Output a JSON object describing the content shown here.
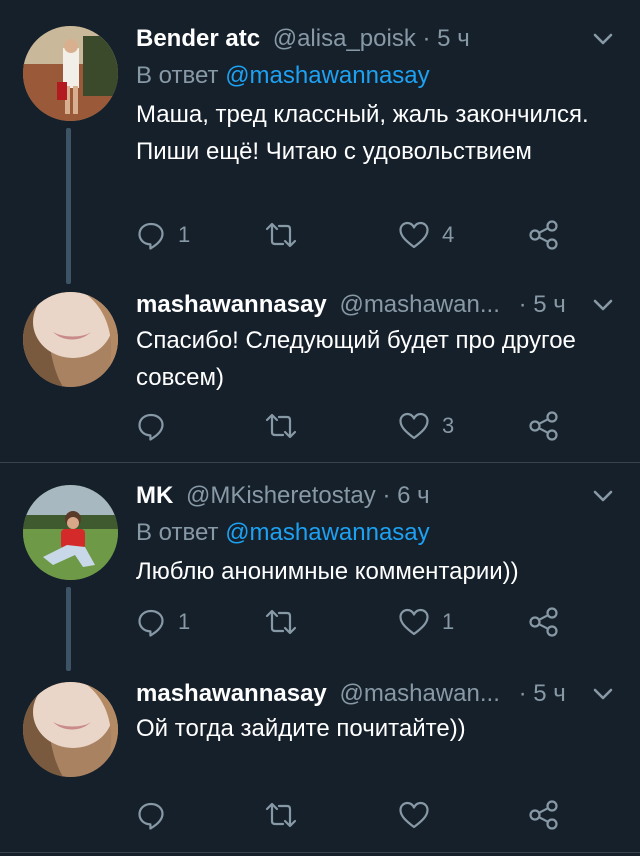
{
  "tweets": [
    {
      "name": "Bender atc",
      "handle": "@alisa_poisk",
      "dot": "·",
      "time": "5 ч",
      "reply_label": "В ответ",
      "reply_to": "@mashawannasay",
      "text": "Маша, тред классный, жаль закончился. Пиши ещё! Читаю с удовольствием",
      "reply_count": "1",
      "retweet_count": "",
      "like_count": "4"
    },
    {
      "name": "mashawannasay",
      "handle": "@mashawan...",
      "dot": "·",
      "time": "5 ч",
      "text": "Спасибо! Следующий будет про другое совсем)",
      "reply_count": "",
      "retweet_count": "",
      "like_count": "3"
    },
    {
      "name": "MK",
      "handle": "@MKisheretostay",
      "dot": "·",
      "time": "6 ч",
      "reply_label": "В ответ",
      "reply_to": "@mashawannasay",
      "text": "Люблю анонимные комментарии))",
      "reply_count": "1",
      "retweet_count": "",
      "like_count": "1"
    },
    {
      "name": "mashawannasay",
      "handle": "@mashawan...",
      "dot": "·",
      "time": "5 ч",
      "text": "Ой тогда зайдите почитайте))",
      "reply_count": "",
      "retweet_count": "",
      "like_count": ""
    }
  ],
  "icons": {
    "reply": "reply-icon",
    "retweet": "retweet-icon",
    "like": "heart-icon",
    "share": "share-icon",
    "menu": "chevron-down-icon"
  },
  "colors": {
    "background": "#15202b",
    "secondary_text": "#8899a6",
    "link": "#1da1f2",
    "thread_line": "#3d5466",
    "divider": "#38444d"
  }
}
